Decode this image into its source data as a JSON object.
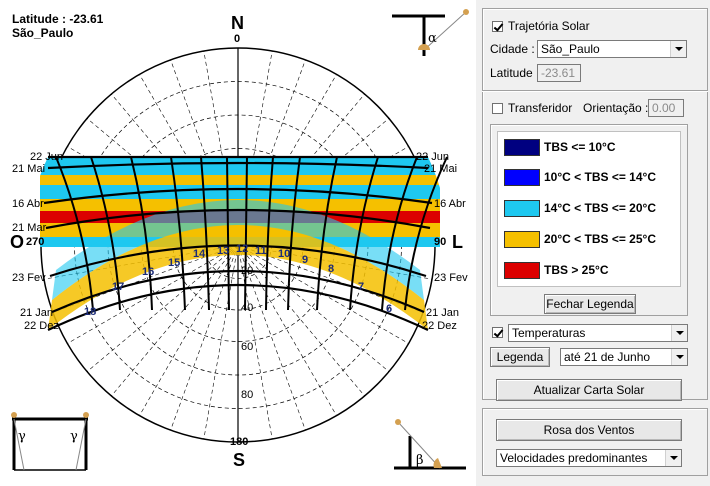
{
  "chart": {
    "latitude_text": "Latitude : -23.61",
    "city_text": "São_Paulo",
    "north": "N",
    "south": "S",
    "west": "O",
    "east": "L",
    "az_top": "0",
    "az_bottom": "180",
    "az_left": "270",
    "az_right": "90",
    "alt_labels": [
      "20",
      "40",
      "60",
      "80"
    ],
    "left_dates": [
      "22 Jun",
      "21 Mai",
      "16 Abr",
      "21 Mar",
      "23 Fev",
      "21 Jan",
      "22 Dez"
    ],
    "right_dates": [
      "22 Jun",
      "21 Mai",
      "16 Abr",
      "21 Mar",
      "23 Fev",
      "21 Jan",
      "22 Dez"
    ],
    "hours": [
      "18",
      "17",
      "16",
      "15",
      "14",
      "13",
      "12",
      "11",
      "10",
      "9",
      "8",
      "7",
      "6"
    ],
    "alpha": "α",
    "gamma": "γ",
    "beta": "β"
  },
  "panel": {
    "trajetoria_label": "Trajetória Solar",
    "trajetoria_checked": true,
    "cidade_label": "Cidade :",
    "cidade_value": "São_Paulo",
    "latitude_label": "Latitude :",
    "latitude_value": "-23.61",
    "transferidor_label": "Transferidor",
    "transferidor_checked": false,
    "orientacao_label": "Orientação :",
    "orientacao_value": "0.00",
    "legend": [
      {
        "color": "#000080",
        "label": "TBS <= 10°C"
      },
      {
        "color": "#0000ff",
        "label": "10°C < TBS <= 14°C"
      },
      {
        "color": "#1ec8f0",
        "label": "14°C < TBS <= 20°C"
      },
      {
        "color": "#f5c000",
        "label": "20°C < TBS <= 25°C"
      },
      {
        "color": "#dc0000",
        "label": "TBS > 25°C"
      }
    ],
    "fechar_legenda": "Fechar Legenda",
    "temperaturas_checked": true,
    "temperaturas_value": "Temperaturas",
    "legenda_button": "Legenda",
    "period_value": "até 21 de Junho",
    "atualizar_button": "Atualizar Carta Solar",
    "rosa_button": "Rosa dos Ventos",
    "ventos_value": "Velocidades predominantes"
  }
}
